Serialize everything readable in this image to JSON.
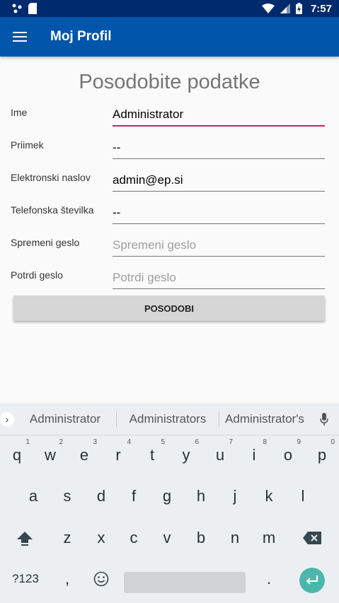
{
  "status_bar": {
    "time": "7:57"
  },
  "app_bar": {
    "title": "Moj Profil"
  },
  "form": {
    "title": "Posodobite podatke",
    "fields": [
      {
        "label": "Ime",
        "value": "Administrator",
        "placeholder": ""
      },
      {
        "label": "Priimek",
        "value": "--",
        "placeholder": ""
      },
      {
        "label": "Elektronski naslov",
        "value": "admin@ep.si",
        "placeholder": ""
      },
      {
        "label": "Telefonska številka",
        "value": "--",
        "placeholder": ""
      },
      {
        "label": "Spremeni geslo",
        "value": "",
        "placeholder": "Spremeni geslo"
      },
      {
        "label": "Potrdi geslo",
        "value": "",
        "placeholder": "Potrdi geslo"
      }
    ],
    "submit_label": "POSODOBI"
  },
  "keyboard": {
    "suggestions": [
      "Administrator",
      "Administrators",
      "Administrator's"
    ],
    "row1": [
      "q",
      "w",
      "e",
      "r",
      "t",
      "y",
      "u",
      "i",
      "o",
      "p"
    ],
    "row1_digits": [
      "1",
      "2",
      "3",
      "4",
      "5",
      "6",
      "7",
      "8",
      "9",
      "0"
    ],
    "row2": [
      "a",
      "s",
      "d",
      "f",
      "g",
      "h",
      "j",
      "k",
      "l"
    ],
    "row3": [
      "z",
      "x",
      "c",
      "v",
      "b",
      "n",
      "m"
    ],
    "symbols_label": "?123",
    "comma": ",",
    "period": "."
  },
  "colors": {
    "app_bar": "#0155ab",
    "status_bar": "#002a6e",
    "accent": "#d81b60",
    "enter": "#4db6ac"
  }
}
